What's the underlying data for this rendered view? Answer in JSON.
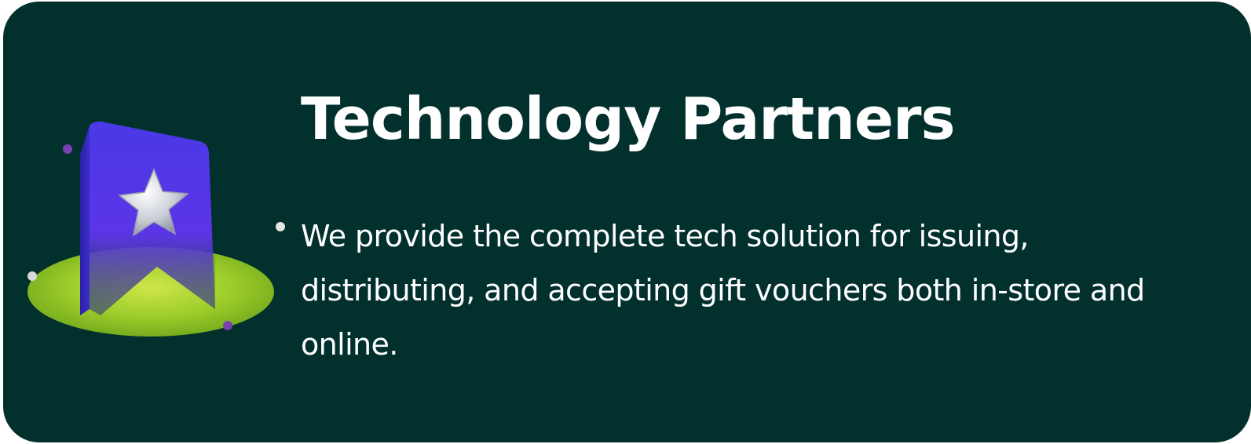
{
  "card": {
    "title": "Technology Partners",
    "description": "We provide the complete tech solution for issuing, distributing, and accepting gift vouchers both in-store and online.",
    "colors": {
      "background": "#02302c",
      "text": "#ffffff",
      "badge": "#5b35e8",
      "platform": "#9ccd2a",
      "star": "#c9cdd6",
      "accent_dot": "#7a3fb0"
    },
    "icons": [
      "bookmark-badge-icon",
      "star-icon",
      "platform-disc"
    ]
  }
}
